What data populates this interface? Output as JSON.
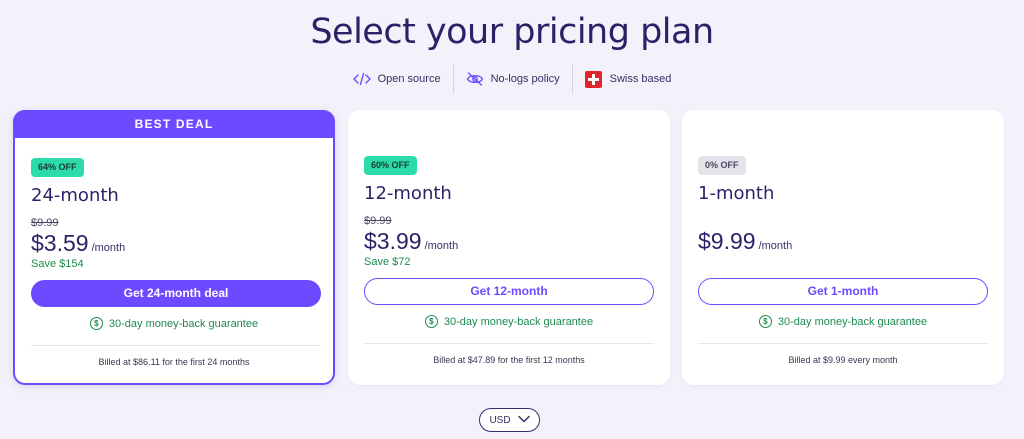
{
  "header": {
    "title": "Select your pricing plan",
    "features": [
      {
        "icon": "code-icon",
        "label": "Open source"
      },
      {
        "icon": "eye-slash-icon",
        "label": "No-logs policy"
      },
      {
        "icon": "swiss-flag-icon",
        "label": "Swiss based"
      }
    ]
  },
  "plans": [
    {
      "ribbon": "BEST DEAL",
      "discount": "64% OFF",
      "name": "24-month",
      "old_price": "$9.99",
      "price": "$3.59",
      "per": "/month",
      "save": "Save $154",
      "cta": "Get 24-month deal",
      "guarantee": "30-day money-back guarantee",
      "billed": "Billed at $86.11 for the first 24 months"
    },
    {
      "discount": "60% OFF",
      "name": "12-month",
      "old_price": "$9.99",
      "price": "$3.99",
      "per": "/month",
      "save": "Save $72",
      "cta": "Get 12-month",
      "guarantee": "30-day money-back guarantee",
      "billed": "Billed at $47.89 for the first 12 months"
    },
    {
      "discount": "0% OFF",
      "name": "1-month",
      "price": "$9.99",
      "per": "/month",
      "cta": "Get 1-month",
      "guarantee": "30-day money-back guarantee",
      "billed": "Billed at $9.99 every month"
    }
  ],
  "currency": {
    "selected": "USD"
  },
  "colors": {
    "accent": "#6d4aff",
    "discount_green": "#2bdcaa",
    "save_green": "#1d8a4e"
  }
}
